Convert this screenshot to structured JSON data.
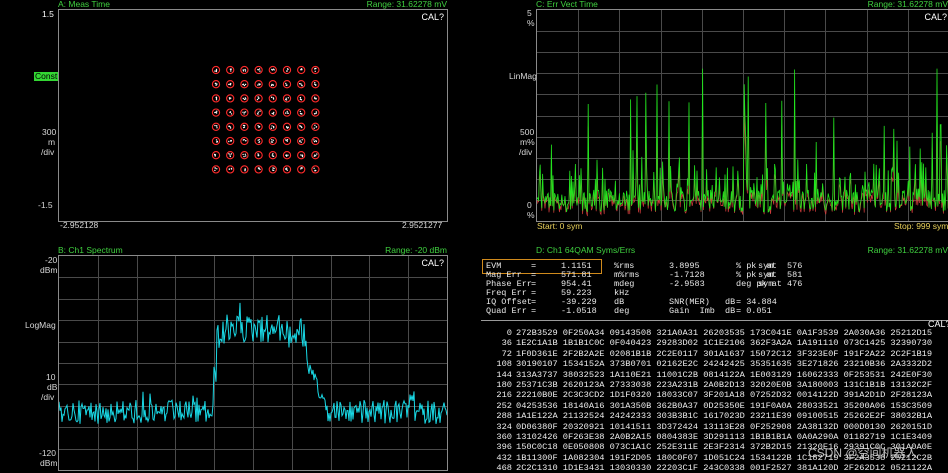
{
  "panelA": {
    "title": "A: Meas Time",
    "range": "Range: 31.62278 mV",
    "cal": "CAL?",
    "y_top": "1.5",
    "y_chip": "Const",
    "y_scale_1": "300",
    "y_scale_2": "m",
    "y_scale_3": "/div",
    "y_bot": "-1.5",
    "x_left": "-2.952128",
    "x_right": "2.9521277"
  },
  "panelB": {
    "title": "B: Ch1 Spectrum",
    "range": "Range: -20 dBm",
    "cal": "CAL?",
    "y_top_1": "-20",
    "y_top_2": "dBm",
    "y_mid": "LogMag",
    "y_scale_1": "10",
    "y_scale_2": "dB",
    "y_scale_3": "/div",
    "y_bot_1": "-120",
    "y_bot_2": "dBm"
  },
  "panelC": {
    "title": "C: Err Vect Time",
    "range": "Range: 31.62278 mV",
    "cal": "CAL?",
    "y_top": "5",
    "y_top_unit": "%",
    "y_mid": "LinMag",
    "y_scale_1": "500",
    "y_scale_2": "m%",
    "y_scale_3": "/div",
    "y_bot_1": "0",
    "y_bot_2": "%",
    "x_start": "Start: 0  sym",
    "x_stop": "Stop: 999  sym"
  },
  "panelD": {
    "title": "D: Ch1 64QAM Syms/Errs",
    "range": "Range: 31.62278 mV",
    "cal": "CAL?",
    "evm": {
      "rows": [
        {
          "name": "EVM",
          "eq": "=",
          "value": "1.1151",
          "unit": "%rms",
          "v2": "3.8995",
          "u2": "% pk  at",
          "sym": "sym",
          "n": "576"
        },
        {
          "name": "Mag Err",
          "eq": "=",
          "value": "571.81",
          "unit": "m%rms",
          "v2": "-1.7128",
          "u2": "% pk  at",
          "sym": "sym",
          "n": "581"
        },
        {
          "name": "Phase Err",
          "eq": "=",
          "value": "954.41",
          "unit": "mdeg",
          "v2": "-2.9583",
          "u2": "deg pk at",
          "sym": "sym",
          "n": "476"
        },
        {
          "name": "Freq Err",
          "eq": "=",
          "value": "59.223",
          "unit": "kHz",
          "v2": "",
          "u2": "",
          "sym": "",
          "n": ""
        },
        {
          "name": "IQ Offset",
          "eq": "=",
          "value": "-39.229",
          "unit": "dB",
          "v2": "SNR(MER)",
          "u2": "= 34.884",
          "sym": "dB",
          "n": ""
        },
        {
          "name": "Quad Err",
          "eq": "=",
          "value": "-1.0518",
          "unit": "deg",
          "v2": "Gain  Imb",
          "u2": "= 0.051",
          "sym": "dB",
          "n": ""
        }
      ]
    },
    "table": [
      {
        "idx": "0",
        "cols": [
          "272B3529",
          "0F250A34",
          "09143508",
          "321A0A31",
          "26203535",
          "173C041E",
          "0A1F3539",
          "2A030A36",
          "25212D15"
        ]
      },
      {
        "idx": "36",
        "cols": [
          "1E2C1A1B",
          "1B1B1C0C",
          "0F040423",
          "29283D02",
          "1C1E2106",
          "362F3A2A",
          "1A191110",
          "073C1425",
          "32390730"
        ]
      },
      {
        "idx": "72",
        "cols": [
          "1F0D361E",
          "2F2B2A2E",
          "02081B1B",
          "2C2E0117",
          "301A1637",
          "15072C12",
          "3F323E0F",
          "191F2A22",
          "2C2F1B19"
        ]
      },
      {
        "idx": "108",
        "cols": [
          "30190107",
          "1534152A",
          "373B0701",
          "02162E2C",
          "24242425",
          "35351635",
          "3E271826",
          "23210B36",
          "2A3332D2"
        ]
      },
      {
        "idx": "144",
        "cols": [
          "313A3737",
          "38032523",
          "1A110E21",
          "11001C2B",
          "0814122A",
          "1E003129",
          "16062333",
          "0F253531",
          "242E0F30"
        ]
      },
      {
        "idx": "180",
        "cols": [
          "25371C3B",
          "2620123A",
          "27333038",
          "223A231B",
          "2A0B2D13",
          "32020E0B",
          "3A180003",
          "131C1B1B",
          "13132C2F"
        ]
      },
      {
        "idx": "216",
        "cols": [
          "22210B0E",
          "2C3C3CD2",
          "1D1F0320",
          "18033C07",
          "3F201A18",
          "07252D32",
          "0014122D",
          "391A2D1D",
          "2F28123A"
        ]
      },
      {
        "idx": "252",
        "cols": [
          "04253536",
          "18140A16",
          "301A350B",
          "362B0A37",
          "0D25350E",
          "191F0A0A",
          "28033521",
          "35200A06",
          "153C3509"
        ]
      },
      {
        "idx": "288",
        "cols": [
          "1A1E122A",
          "21132524",
          "24242333",
          "303B3B1C",
          "1617023D",
          "23211E39",
          "09100515",
          "25262E2F",
          "38032B1A"
        ]
      },
      {
        "idx": "324",
        "cols": [
          "0D06380F",
          "20320921",
          "10141511",
          "3D372424",
          "13113E28",
          "0F252908",
          "2A38132D",
          "000D0130",
          "2620151D"
        ]
      },
      {
        "idx": "360",
        "cols": [
          "13102426",
          "0F263E38",
          "2A0B2A15",
          "0804383E",
          "3D291113",
          "1B1B1B1A",
          "0A0A290A",
          "01182719",
          "1C1E3409"
        ]
      },
      {
        "idx": "396",
        "cols": [
          "150C0C18",
          "0E050808",
          "073C1A1C",
          "252E311E",
          "2E3F2314",
          "372B2D15",
          "21320E16",
          "29391C0C",
          "301A0A0E"
        ]
      },
      {
        "idx": "432",
        "cols": [
          "1B11300F",
          "1A082304",
          "191F2D05",
          "180C0F07",
          "1D051C24",
          "1534122B",
          "1C182719",
          "3F2A3538",
          "25212C2B"
        ]
      },
      {
        "idx": "468",
        "cols": [
          "2C2C1310",
          "1D1E3431",
          "13030330",
          "22203C1F",
          "243C0338",
          "001F2527",
          "381A120D",
          "2F262D12",
          "0521122A"
        ]
      }
    ]
  },
  "watermark": "CSDN @空间机器人",
  "colors": {
    "header": "#3fd13f",
    "const": "#ff2a2a",
    "spectrum": "#19d9e6",
    "err_green": "#22e51e",
    "err_red": "#d23c3c",
    "box": "#d08a1c"
  }
}
